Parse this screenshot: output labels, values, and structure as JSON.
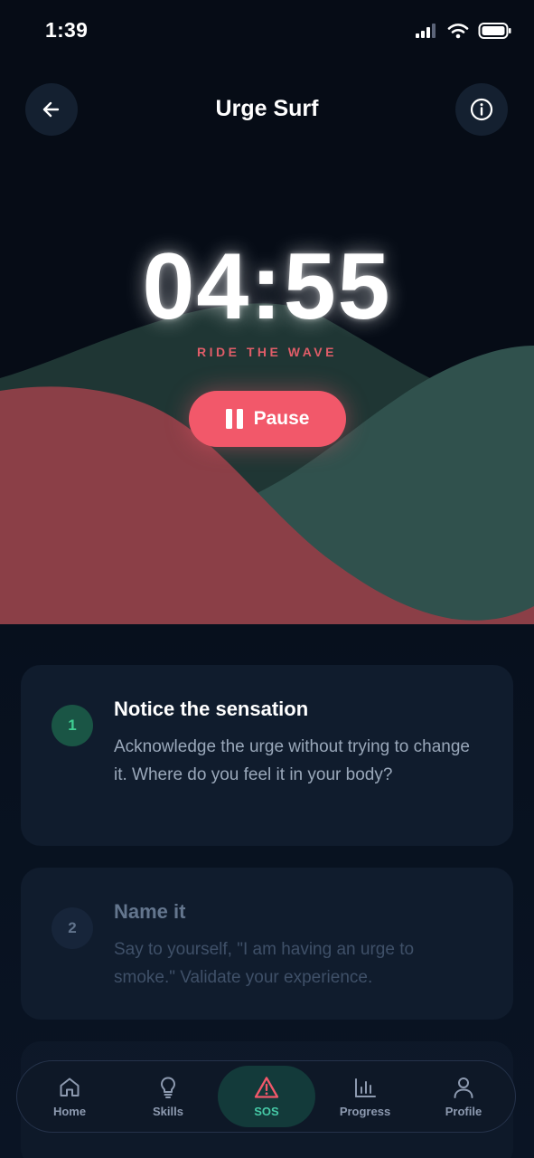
{
  "status_bar": {
    "time": "1:39"
  },
  "header": {
    "title": "Urge Surf",
    "back_icon": "arrow-left-icon",
    "info_icon": "info-circle-icon"
  },
  "timer": {
    "display": "04:55",
    "caption": "RIDE THE WAVE",
    "pause_label": "Pause"
  },
  "steps": [
    {
      "number": "1",
      "title": "Notice the sensation",
      "description": "Acknowledge the urge without trying to change it. Where do you feel it in your body?",
      "state": "active"
    },
    {
      "number": "2",
      "title": "Name it",
      "description": "Say to yourself, \"I am having an urge to smoke.\" Validate your experience.",
      "state": "upcoming"
    }
  ],
  "nav": {
    "items": [
      {
        "label": "Home",
        "icon": "home-icon",
        "active": false
      },
      {
        "label": "Skills",
        "icon": "lightbulb-icon",
        "active": false
      },
      {
        "label": "SOS",
        "icon": "warning-triangle-icon",
        "active": true
      },
      {
        "label": "Progress",
        "icon": "bar-chart-icon",
        "active": false
      },
      {
        "label": "Profile",
        "icon": "user-icon",
        "active": false
      }
    ]
  },
  "colors": {
    "accent_coral": "#f2586a",
    "accent_teal": "#46c9a6",
    "wave_red": "#8b3f47",
    "wave_teal": "#2f4f4c",
    "background": "#0b1322"
  }
}
